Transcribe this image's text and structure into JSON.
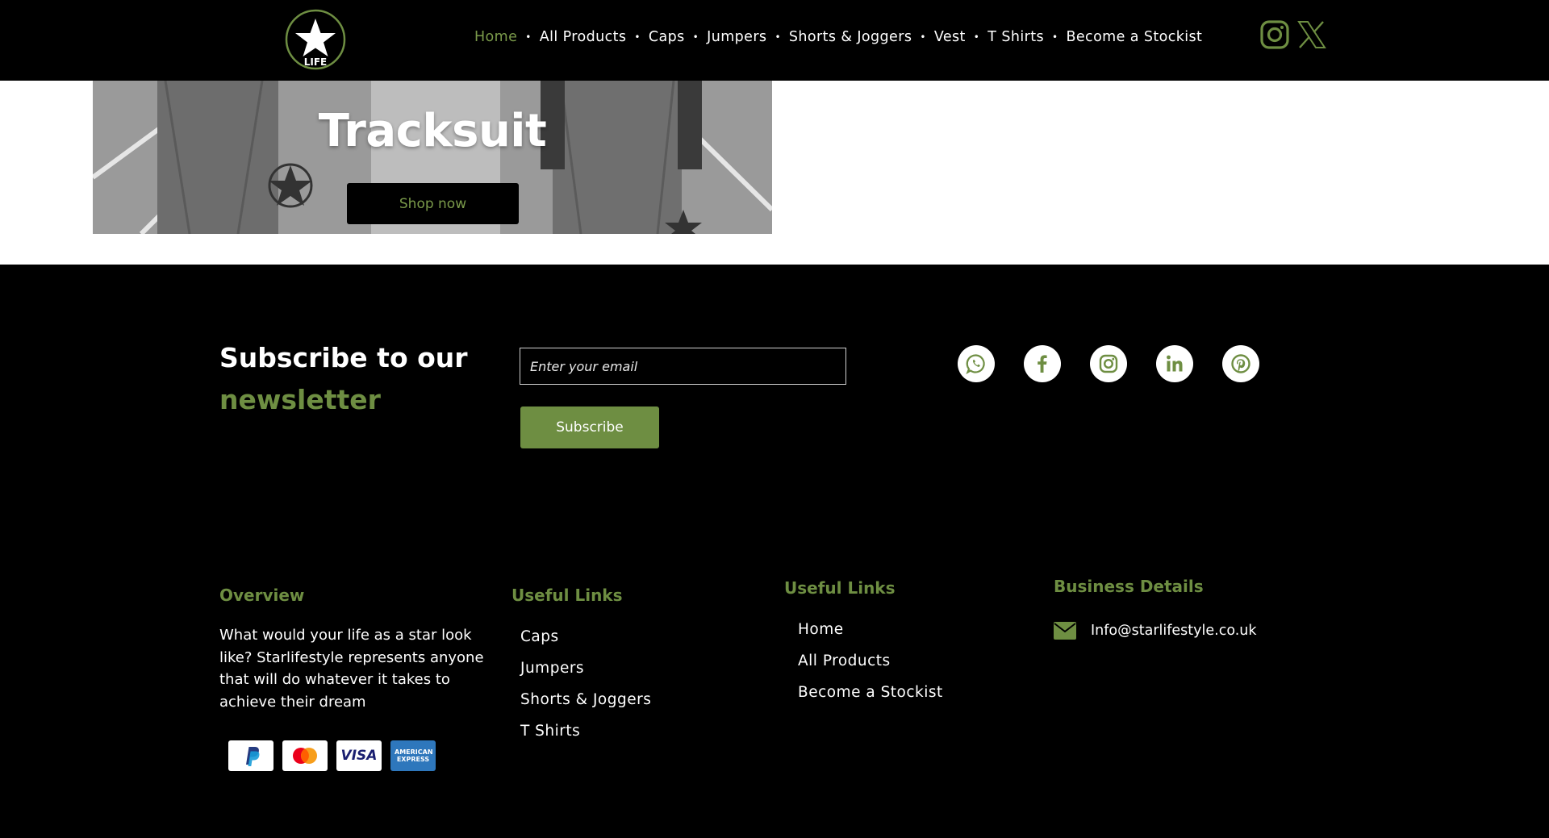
{
  "nav": {
    "items": [
      {
        "label": "Home",
        "active": true
      },
      {
        "label": "All Products"
      },
      {
        "label": "Caps"
      },
      {
        "label": "Jumpers"
      },
      {
        "label": "Shorts & Joggers"
      },
      {
        "label": "Vest"
      },
      {
        "label": "T Shirts"
      },
      {
        "label": "Become a Stockist"
      }
    ],
    "social_icons": [
      "instagram-icon",
      "x-icon"
    ]
  },
  "logo": {
    "text": "LIFE"
  },
  "hero": {
    "title": "Tracksuit",
    "button_label": "Shop now"
  },
  "newsletter": {
    "title_line1": "Subscribe to our",
    "title_line2": "newsletter",
    "email_placeholder": "Enter your email",
    "button_label": "Subscribe"
  },
  "social_icons": [
    "whatsapp-icon",
    "facebook-icon",
    "instagram-icon",
    "linkedin-icon",
    "pinterest-icon"
  ],
  "footer": {
    "overview": {
      "title": "Overview",
      "text": "What would your life as a star look like? Starlifestyle represents anyone that will do whatever it takes to achieve their dream"
    },
    "useful_links_1": {
      "title": "Useful Links",
      "items": [
        "Caps",
        "Jumpers",
        "Shorts & Joggers",
        "T Shirts"
      ]
    },
    "useful_links_2": {
      "title": "Useful Links",
      "items": [
        "Home",
        "All Products",
        "Become a Stockist"
      ]
    },
    "business": {
      "title": "Business Details",
      "email": "Info@starlifestyle.co.uk"
    },
    "payments": [
      "paypal-icon",
      "mastercard-icon",
      "visa-icon",
      "amex-icon"
    ],
    "payment_text": {
      "visa": "VISA",
      "amex": "AMERICAN EXPRESS"
    }
  },
  "colors": {
    "accent": "#6e8e42",
    "background": "#000000",
    "text": "#ffffff"
  }
}
